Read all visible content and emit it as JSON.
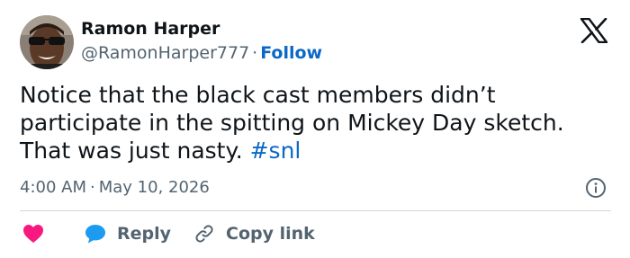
{
  "author": {
    "name": "Ramon Harper",
    "handle": "@RamonHarper777",
    "separator": "·",
    "follow_label": "Follow"
  },
  "tweet": {
    "text": "Notice that the black cast members didn’t participate in the spitting on Mickey Day sketch. That was just nasty. ",
    "hashtag": "#snl"
  },
  "meta": {
    "time": "4:00 AM",
    "separator": "·",
    "date": "May 10, 2026"
  },
  "actions": {
    "reply_label": "Reply",
    "copy_link_label": "Copy link"
  },
  "icons": {
    "platform": "x-logo-icon",
    "info": "info-icon",
    "like": "heart-icon",
    "reply": "speech-bubble-icon",
    "copy": "link-icon"
  },
  "colors": {
    "link": "#0b68c7",
    "text": "#0f1419",
    "secondary": "#536471",
    "heart": "#f91880",
    "reply_bubble": "#1d9bf0",
    "divider": "#cfd9de"
  }
}
